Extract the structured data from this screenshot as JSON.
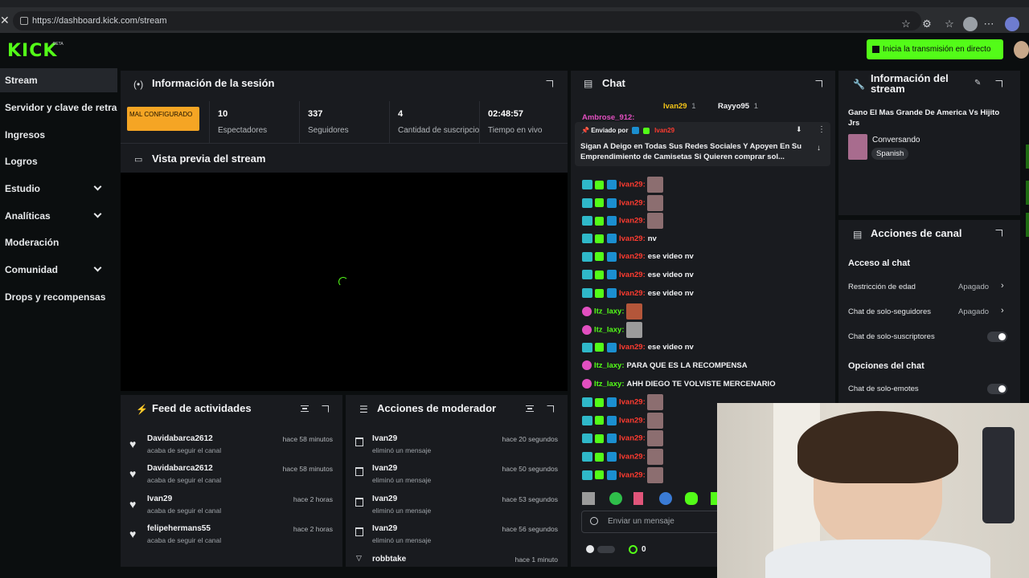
{
  "browser": {
    "url": "https://dashboard.kick.com/stream"
  },
  "header": {
    "logo_text": "KICK",
    "logo_beta": "BETA",
    "go_live_label": "Inicia la transmisión en directo"
  },
  "sidebar": {
    "items": [
      {
        "label": "Stream",
        "active": true,
        "expandable": false
      },
      {
        "label": "Servidor y clave de retransmisión",
        "active": false,
        "expandable": false
      },
      {
        "label": "Ingresos",
        "active": false,
        "expandable": false
      },
      {
        "label": "Logros",
        "active": false,
        "expandable": false
      },
      {
        "label": "Estudio",
        "active": false,
        "expandable": true
      },
      {
        "label": "Analíticas",
        "active": false,
        "expandable": true
      },
      {
        "label": "Moderación",
        "active": false,
        "expandable": false
      },
      {
        "label": "Comunidad",
        "active": false,
        "expandable": true
      },
      {
        "label": "Drops y recompensas",
        "active": false,
        "expandable": false
      }
    ]
  },
  "session": {
    "title": "Información de la sesión",
    "status_badge": "MAL CONFIGURADO",
    "stats": [
      {
        "value": "10",
        "label": "Espectadores"
      },
      {
        "value": "337",
        "label": "Seguidores"
      },
      {
        "value": "4",
        "label": "Cantidad de suscripciones"
      },
      {
        "value": "02:48:57",
        "label": "Tiempo en vivo"
      }
    ]
  },
  "preview": {
    "title": "Vista previa del stream"
  },
  "activity_feed": {
    "title": "Feed de actividades",
    "items": [
      {
        "user": "Davidabarca2612",
        "action": "acaba de seguir el canal",
        "time": "hace 58 minutos"
      },
      {
        "user": "Davidabarca2612",
        "action": "acaba de seguir el canal",
        "time": "hace 58 minutos"
      },
      {
        "user": "Ivan29",
        "action": "acaba de seguir el canal",
        "time": "hace 2 horas"
      },
      {
        "user": "felipehermans55",
        "action": "acaba de seguir el canal",
        "time": "hace 2 horas"
      }
    ]
  },
  "mod_actions": {
    "title": "Acciones de moderador",
    "items": [
      {
        "user": "Ivan29",
        "action": "eliminó un mensaje",
        "time": "hace 20 segundos"
      },
      {
        "user": "Ivan29",
        "action": "eliminó un mensaje",
        "time": "hace 50 segundos"
      },
      {
        "user": "Ivan29",
        "action": "eliminó un mensaje",
        "time": "hace 53 segundos"
      },
      {
        "user": "Ivan29",
        "action": "eliminó un mensaje",
        "time": "hace 56 segundos"
      },
      {
        "user": "robbtake",
        "action": "",
        "time": "hace 1 minuto"
      }
    ]
  },
  "chat": {
    "title": "Chat",
    "top_users": [
      {
        "name": "Ivan29",
        "count": "1"
      },
      {
        "name": "Rayyo95",
        "count": "1"
      }
    ],
    "partial_user": "Ambrose_912:",
    "pinned": {
      "label": "Enviado por",
      "user": "Ivan29",
      "text": "Sigan A Deigo en Todas Sus Redes Sociales Y Apoyen En Su Emprendimiento de Camisetas Si Quieren comprar sol..."
    },
    "messages": [
      {
        "user": "Ivan29:",
        "text": "",
        "color": "red",
        "badges": "sub",
        "emote": "default"
      },
      {
        "user": "Ivan29:",
        "text": "",
        "color": "red",
        "badges": "sub",
        "emote": "default"
      },
      {
        "user": "Ivan29:",
        "text": "",
        "color": "red",
        "badges": "sub",
        "emote": "default"
      },
      {
        "user": "Ivan29:",
        "text": "nv",
        "color": "red",
        "badges": "sub",
        "emote": ""
      },
      {
        "user": "Ivan29:",
        "text": "ese video nv",
        "color": "red",
        "badges": "sub",
        "emote": ""
      },
      {
        "user": "Ivan29:",
        "text": "ese video nv",
        "color": "red",
        "badges": "sub",
        "emote": ""
      },
      {
        "user": "Ivan29:",
        "text": "ese video nv",
        "color": "red",
        "badges": "sub",
        "emote": ""
      },
      {
        "user": "Itz_laxy:",
        "text": "",
        "color": "green",
        "badges": "pink",
        "emote": "orange"
      },
      {
        "user": "Itz_laxy:",
        "text": "",
        "color": "green",
        "badges": "pink",
        "emote": "gray"
      },
      {
        "user": "Ivan29:",
        "text": "ese video nv",
        "color": "red",
        "badges": "sub",
        "emote": ""
      },
      {
        "user": "Itz_laxy:",
        "text": "PARA QUE ES LA RECOMPENSA",
        "color": "green",
        "badges": "pink",
        "emote": ""
      },
      {
        "user": "Itz_laxy:",
        "text": "AHH DIEGO TE VOLVISTE MERCENARIO",
        "color": "green",
        "badges": "pink",
        "emote": ""
      },
      {
        "user": "Ivan29:",
        "text": "",
        "color": "red",
        "badges": "sub",
        "emote": "default"
      },
      {
        "user": "Ivan29:",
        "text": "",
        "color": "red",
        "badges": "sub",
        "emote": "default"
      },
      {
        "user": "Ivan29:",
        "text": "",
        "color": "red",
        "badges": "sub",
        "emote": "default"
      },
      {
        "user": "Ivan29:",
        "text": "",
        "color": "red",
        "badges": "sub",
        "emote": "default"
      },
      {
        "user": "Ivan29:",
        "text": "",
        "color": "red",
        "badges": "sub",
        "emote": "default"
      }
    ],
    "input_placeholder": "Enviar un mensaje",
    "points": "0"
  },
  "stream_info": {
    "title": "Información del stream",
    "stream_title": "Gano El Mas Grande De America Vs Hijito Jrs",
    "category": "Conversando",
    "language": "Spanish"
  },
  "channel_actions": {
    "title": "Acciones de canal",
    "chat_access_heading": "Acceso al chat",
    "rows": [
      {
        "label": "Restricción de edad",
        "value": "Apagado",
        "type": "link"
      },
      {
        "label": "Chat de solo-seguidores",
        "value": "Apagado",
        "type": "link"
      },
      {
        "label": "Chat de solo-suscriptores",
        "value": "",
        "type": "toggle"
      }
    ],
    "chat_options_heading": "Opciones del chat",
    "option_rows": [
      {
        "label": "Chat de solo-emotes",
        "value": "",
        "type": "toggle"
      }
    ]
  },
  "colors": {
    "brand": "#53fc18",
    "warning": "#f5a524",
    "username_red": "#ff3b30"
  }
}
